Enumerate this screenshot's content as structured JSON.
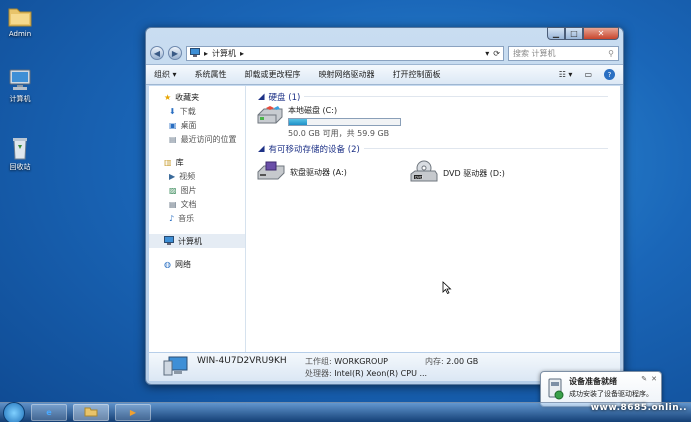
{
  "desktop": {
    "icons": [
      {
        "label": "Admin",
        "icon": "folder-icon"
      },
      {
        "label": "计算机",
        "icon": "computer-icon"
      },
      {
        "label": "回收站",
        "icon": "recycle-bin-icon"
      }
    ]
  },
  "window": {
    "address": {
      "crumb": "计算机",
      "separator": "▸"
    },
    "search_placeholder": "搜索 计算机",
    "toolbar": [
      "组织 ▾",
      "系统属性",
      "卸载或更改程序",
      "映射网络驱动器",
      "打开控制面板"
    ],
    "nav": {
      "favorites": {
        "label": "收藏夹",
        "items": [
          "下载",
          "桌面",
          "最近访问的位置"
        ]
      },
      "libraries": {
        "label": "库",
        "items": [
          "视频",
          "图片",
          "文档",
          "音乐"
        ]
      },
      "computer": "计算机",
      "network": "网络"
    },
    "groups": {
      "hard_disks": "硬盘 (1)",
      "removable": "有可移动存储的设备 (2)"
    },
    "drives": {
      "c": {
        "name": "本地磁盘 (C:)",
        "free_text": "50.0 GB 可用，共 59.9 GB",
        "used_fraction": 0.165
      },
      "a": {
        "name": "软盘驱动器 (A:)"
      },
      "d": {
        "name": "DVD 驱动器 (D:)"
      }
    },
    "details": {
      "computer_name": "WIN-4U7D2VRU9KH",
      "workgroup_label": "工作组:",
      "workgroup": "WORKGROUP",
      "memory_label": "内存:",
      "memory": "2.00 GB",
      "processor_label": "处理器:",
      "processor": "Intel(R) Xeon(R) CPU ..."
    }
  },
  "notification": {
    "title": "设备准备就绪",
    "message": "成功安装了设备驱动程序。"
  },
  "watermark": "www.8685.onlin..",
  "colors": {
    "accent": "#1e3287",
    "desktop": "#1a66b8",
    "progress": "#1e90c8"
  }
}
